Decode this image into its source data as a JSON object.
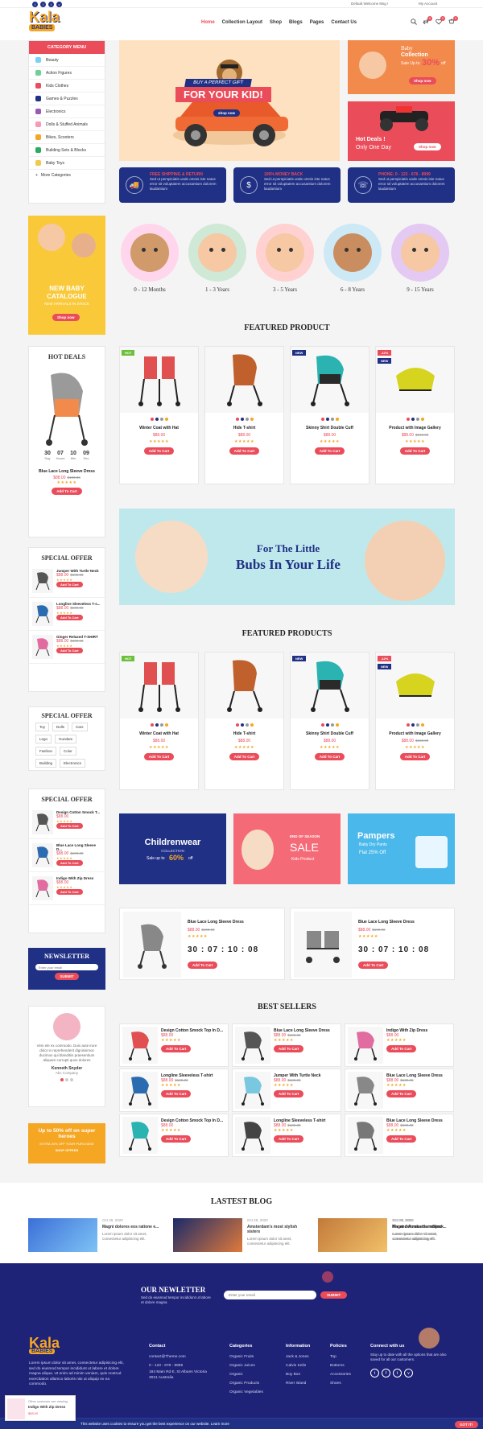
{
  "topbar": {
    "social": [
      "t",
      "f",
      "t",
      "v"
    ],
    "welcome": "Default Welcome Msg !",
    "account": "My Account"
  },
  "header": {
    "logo_top": "Kala",
    "logo_bottom": "BABIES",
    "nav": [
      "Home",
      "Collection Layout",
      "Shop",
      "Blogs",
      "Pages",
      "Contact Us"
    ],
    "badges": [
      "0",
      "0",
      "0"
    ]
  },
  "category_menu": {
    "title": "CATEGORY MENU",
    "items": [
      "Beauty",
      "Action Figures",
      "Kids Clothes",
      "Games & Puzzles",
      "Electronics",
      "Dolls & Stuffed Animals",
      "Bikes, Scooters",
      "Building Sets & Blocks",
      "Baby Toys"
    ],
    "more": "More Categories"
  },
  "hero": {
    "ribbon": "BUY A PERFECT GIFT",
    "title": "FOR YOUR KID!",
    "button": "shop now"
  },
  "promo_top": {
    "line1": "Baby",
    "line2": "Collection",
    "line3": "Sale Up to",
    "pct": "30%",
    "off": "off",
    "button": "Shop now"
  },
  "promo_mid": {
    "line1": "Hot Deals !",
    "line2": "Only One Day",
    "button": "Shop now"
  },
  "features": [
    {
      "title": "FREE SHIPPING & RETURN",
      "desc": "Sed ut perspiciatis unde omnis iste natus error sit voluptatem accusantium dolorem laudantium",
      "icon": "truck-icon"
    },
    {
      "title": "100% MONEY BACK",
      "desc": "Sed ut perspiciatis unde omnis iste natus error sit voluptatem accusantium dolorem laudantium",
      "icon": "dollar-icon"
    },
    {
      "title": "PHONE: 0 - 123 - 678 - 8999",
      "desc": "Sed ut perspiciatis unde omnis iste natus error sit voluptatem accusantium dolorem laudantium",
      "icon": "phone-icon"
    }
  ],
  "side_catalogue": {
    "line1": "NEW BABY",
    "line2": "CATALOGUE",
    "line3": "NEW ARRIVALS IN STOCK",
    "button": "Shop now"
  },
  "ages": [
    "0 - 12 Months",
    "1 - 3 Years",
    "3 - 5 Years",
    "6 - 8 Years",
    "9 - 15 Years"
  ],
  "hot_deals": {
    "title": "HOT DEALS",
    "countdown": [
      {
        "v": "30",
        "l": "Day"
      },
      {
        "v": "07",
        "l": "Hours"
      },
      {
        "v": "10",
        "l": "Min"
      },
      {
        "v": "09",
        "l": "Sec"
      }
    ],
    "name": "Blue Lace Long Sleeve Dress",
    "price": "$88.00",
    "old": "$100.00",
    "button": "Add To Cart"
  },
  "featured1": {
    "title": "FEATURED PRODUCT",
    "products": [
      {
        "tag": "HOT",
        "name": "Winter Coat with Hat",
        "price": "$88.00",
        "button": "Add To Cart"
      },
      {
        "tag": "",
        "name": "Hide T-shirt",
        "price": "$88.00",
        "button": "Add To Cart"
      },
      {
        "tag": "NEW",
        "name": "Skinny Shirt Double Cuff",
        "price": "$88.00",
        "button": "Add To Cart"
      },
      {
        "tag": "-12%",
        "name": "Product with Image Gallery",
        "price": "$88.00",
        "old": "$100.00",
        "button": "Add To Cart",
        "tag2": "NEW"
      }
    ]
  },
  "banner": {
    "line1": "For The Little",
    "line2": "Bubs In Your Life"
  },
  "featured2": {
    "title": "FEATURED PRODUCTS",
    "products": [
      {
        "tag": "HOT",
        "name": "Winter Coat with Hat",
        "price": "$88.00",
        "button": "Add To Cart"
      },
      {
        "tag": "",
        "name": "Hide T-shirt",
        "price": "$88.00",
        "button": "Add To Cart"
      },
      {
        "tag": "NEW",
        "name": "Skinny Shirt Double Cuff",
        "price": "$88.00",
        "button": "Add To Cart"
      },
      {
        "tag": "-12%",
        "name": "Product with Image Gallery",
        "price": "$88.00",
        "old": "$100.00",
        "button": "Add To Cart",
        "tag2": "NEW"
      }
    ]
  },
  "special_offer": {
    "title": "SPECIAL OFFER",
    "items": [
      {
        "name": "Jumper With Turtle Neck",
        "price": "$88.00",
        "old": "$100.00",
        "button": "Add To Cart"
      },
      {
        "name": "Longline Sleeveless T-s...",
        "price": "$88.00",
        "old": "$100.00",
        "button": "Add To Cart"
      },
      {
        "name": "Ginger Relaxed T-SHIRT",
        "price": "$88.00",
        "old": "$100.00",
        "button": "Add To Cart"
      }
    ]
  },
  "tags_box": {
    "title": "SPECIAL OFFER",
    "tags": [
      "Toy",
      "Dolls",
      "Cars",
      "Lego",
      "Gundam",
      "Fashion",
      "Color",
      "Building",
      "Electronics"
    ]
  },
  "special_offer2": {
    "title": "SPECIAL OFFER",
    "items": [
      {
        "name": "Design Cotton Smock T...",
        "price": "$88.00",
        "button": "Add To Cart"
      },
      {
        "name": "Blue Lace Long Sleeve D...",
        "price": "$88.00",
        "old": "$100.00",
        "button": "Add To Cart"
      },
      {
        "name": "Indigo With Zip Dress",
        "price": "$88.00",
        "button": "Add To Cart"
      }
    ]
  },
  "three_banners": {
    "b1": {
      "t1": "Childrenwear",
      "t2": "COLLECTION",
      "t3": "Sale up to",
      "pct": "60%",
      "off": "off"
    },
    "b2": {
      "t1": "END OF SEASON",
      "t2": "SALE",
      "t3": "Kids Product"
    },
    "b3": {
      "t1": "Pampers",
      "t2": "Baby Dry Pants",
      "t3": "Flat 25% Off"
    }
  },
  "deal_cards": [
    {
      "name": "Blue Lace Long Sleeve Dress",
      "price": "$88.00",
      "old": "$100.00",
      "count": "30 : 07 : 10 : 08",
      "button": "Add To Cart"
    },
    {
      "name": "Blue Lace Long Sleeve Dress",
      "price": "$88.00",
      "old": "$100.00",
      "count": "30 : 07 : 10 : 08",
      "button": "Add To Cart"
    }
  ],
  "newsletter_side": {
    "title": "NEWSLETTER",
    "placeholder": "Enter your email",
    "button": "SUBMIT"
  },
  "testimonial": {
    "text": "Veni ele ex commodo. Duis aute irure dolor in reprehenderit dignissimos ducimus qui blanditiis praesentium aliquam corrupti quos dolores",
    "name": "Kenneth Snyder",
    "role": "Abc Company"
  },
  "side_promo": {
    "t1": "Up to 50% off on super heroes",
    "t2": "EXTRA 20% OFF YOUR PURCHASE",
    "t3": "SHOP OFFERS"
  },
  "best_sellers": {
    "title": "BEST SELLERS",
    "items": [
      {
        "name": "Design Cotton Smock Top In D...",
        "price": "$88.00",
        "button": "Add To Cart"
      },
      {
        "name": "Blue Lace Long Sleeve Dress",
        "price": "$88.00",
        "old": "$100.00",
        "button": "Add To Cart"
      },
      {
        "name": "Indigo With Zip Dress",
        "price": "$88.00",
        "button": "Add To Cart"
      },
      {
        "name": "Longline Sleeveless T-shirt",
        "price": "$88.00",
        "old": "$100.00",
        "button": "Add To Cart"
      },
      {
        "name": "Jumper With Turtle Neck",
        "price": "$88.00",
        "old": "$100.00",
        "button": "Add To Cart"
      },
      {
        "name": "Blue Lace Long Sleeve Dress",
        "price": "$88.00",
        "old": "$100.00",
        "button": "Add To Cart"
      },
      {
        "name": "Design Cotton Smock Top In D...",
        "price": "$88.00",
        "button": "Add To Cart"
      },
      {
        "name": "Longline Sleeveless T-shirt",
        "price": "$88.00",
        "old": "$100.00",
        "button": "Add To Cart"
      },
      {
        "name": "Blue Lace Long Sleeve Dress",
        "price": "$88.00",
        "old": "$100.00",
        "button": "Add To Cart"
      }
    ]
  },
  "blog": {
    "title": "LASTEST BLOG",
    "posts": [
      {
        "date": "Oct 29, 2020",
        "title": "Magni dolores eos ratione e...",
        "excerpt": "Lorem ipsum dolor sit amet, consectetur adipisicing elit."
      },
      {
        "date": "Oct 29, 2020",
        "title": "Amsterdam's most stylish sisters",
        "excerpt": "Lorem ipsum dolor sit amet, consectetur adipisicing elit."
      },
      {
        "date": "Oct 29, 2020",
        "title": "Magni dolores eos ratione ...",
        "excerpt": "Lorem ipsum dolor sit amet, consectetur adipisicing elit."
      },
      {
        "date": "Oct 29, 2020",
        "title": "Fix and Amaka Hamelijnck",
        "excerpt": "Lorem ipsum dolor sit amet, consectetur adipisicing elit."
      }
    ]
  },
  "footer": {
    "news_title": "OUR NEWLETTER",
    "news_desc": "Sed do eiusmod tempor incididunt ut labore et dolore magna",
    "news_placeholder": "Enter your email",
    "news_button": "SUBMIT",
    "about": "Lorem ipsum dolor sit amet, consectetur adipisicing elit, sed do eiusmod tempor incididunt ut labore et dolore magna aliqua. Ut enim ad minim veniam, quis nostrud exercitation ullamco laboris nisi ut aliquip ex ea commodo.",
    "contact_h": "Contact",
    "contact": [
      "contact@Theme.com",
      "0 - 123 - 678 - 8999",
      "184 Main Rd E, St Albans Victoria 3021 Australia"
    ],
    "cat_h": "Categories",
    "cats": [
      "Organic Fruits",
      "Organic Juices",
      "Organic",
      "Organic Products",
      "Organic Vegetables"
    ],
    "info_h": "Information",
    "info": [
      "Jack & Jones",
      "Calvin Kelin",
      "Boy Bon",
      "River Island"
    ],
    "pol_h": "Policies",
    "pol": [
      "Top",
      "Bottoms",
      "Accessories",
      "Shoes"
    ],
    "connect_h": "Connect with us",
    "connect": "Stay up to date with all the options that are also saved for all our customers."
  },
  "cookie": {
    "text": "This website uses cookies to ensure you get the best experience on our website. Learn more",
    "button": "GOT IT!"
  },
  "popup": {
    "line1": "Other customer are viewing",
    "line2": "Indigo With Zip Dress",
    "line3": "$88.00"
  },
  "colors": {
    "accent": "#ea4c5a",
    "navy": "#203085",
    "orange": "#f5a623"
  }
}
